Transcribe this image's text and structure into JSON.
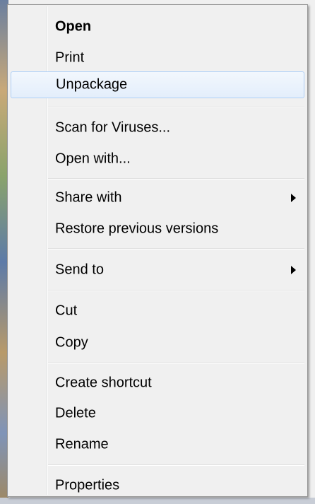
{
  "menu": {
    "items": [
      {
        "label": "Open",
        "bold": true
      },
      {
        "label": "Print"
      },
      {
        "label": "Unpackage",
        "highlighted": true
      },
      {
        "label": "Scan for Viruses..."
      },
      {
        "label": "Open with..."
      },
      {
        "label": "Share with",
        "submenu": true
      },
      {
        "label": "Restore previous versions"
      },
      {
        "label": "Send to",
        "submenu": true
      },
      {
        "label": "Cut"
      },
      {
        "label": "Copy"
      },
      {
        "label": "Create shortcut"
      },
      {
        "label": "Delete"
      },
      {
        "label": "Rename"
      },
      {
        "label": "Properties"
      }
    ]
  },
  "icons": {
    "submenu_arrow": "chevron-right-icon"
  },
  "colors": {
    "menu_background": "#f0f0f0",
    "highlight_border": "#aecff7",
    "highlight_fill": "#e3eefb"
  }
}
